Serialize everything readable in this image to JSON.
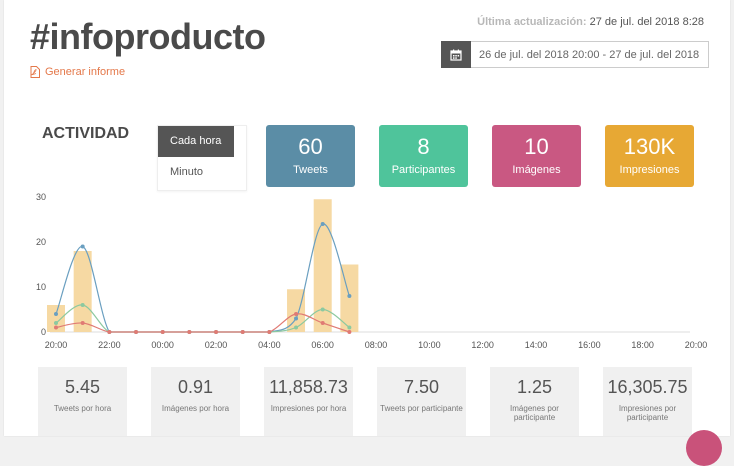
{
  "header": {
    "title": "#infoproducto",
    "report_link": "Generar informe",
    "updated_label": "Última actualización:",
    "updated_value": "27 de jul. del 2018 8:28",
    "date_range": "26 de jul. del 2018 20:00 - 27 de jul. del 2018 08:00"
  },
  "activity": {
    "title": "ACTIVIDAD",
    "options": [
      "Cada hora",
      "Minuto"
    ],
    "selected": "Cada hora"
  },
  "stats": [
    {
      "value": "60",
      "label": "Tweets",
      "color": "#5b8da6"
    },
    {
      "value": "8",
      "label": "Participantes",
      "color": "#4fc49b"
    },
    {
      "value": "10",
      "label": "Imágenes",
      "color": "#c95882"
    },
    {
      "value": "130K",
      "label": "Impresiones",
      "color": "#e7a834"
    }
  ],
  "chart_data": {
    "type": "bar",
    "x": [
      "20:00",
      "21:00",
      "22:00",
      "23:00",
      "00:00",
      "01:00",
      "02:00",
      "03:00",
      "04:00",
      "05:00",
      "06:00",
      "07:00"
    ],
    "x_ticks": [
      "20:00",
      "22:00",
      "00:00",
      "02:00",
      "04:00",
      "06:00",
      "08:00",
      "10:00",
      "12:00",
      "14:00",
      "16:00",
      "18:00",
      "20:00"
    ],
    "y_ticks": [
      "0",
      "10",
      "20",
      "30"
    ],
    "ylim": [
      0,
      30
    ],
    "bars": [
      6,
      18,
      0,
      0,
      0,
      0,
      0,
      0,
      0,
      9.5,
      29.5,
      15
    ],
    "series": [
      {
        "color": "#6a9fc0",
        "values": [
          4,
          19,
          0,
          0,
          0,
          0,
          0,
          0,
          0,
          3,
          24,
          8
        ]
      },
      {
        "color": "#8cc9a0",
        "values": [
          2,
          6,
          0,
          0,
          0,
          0,
          0,
          0,
          0,
          1,
          5,
          1
        ]
      },
      {
        "color": "#e07a74",
        "values": [
          1,
          2,
          0,
          0,
          0,
          0,
          0,
          0,
          0,
          4,
          2,
          0
        ]
      }
    ],
    "bar_color": "#f6d9a3",
    "grid": false
  },
  "metrics": [
    {
      "value": "5.45",
      "label": "Tweets por hora"
    },
    {
      "value": "0.91",
      "label": "Imágenes por hora"
    },
    {
      "value": "11,858.73",
      "label": "Impresiones por hora"
    },
    {
      "value": "7.50",
      "label": "Tweets por participante"
    },
    {
      "value": "1.25",
      "label": "Imágenes por participante"
    },
    {
      "value": "16,305.75",
      "label": "Impresiones por participante"
    }
  ]
}
